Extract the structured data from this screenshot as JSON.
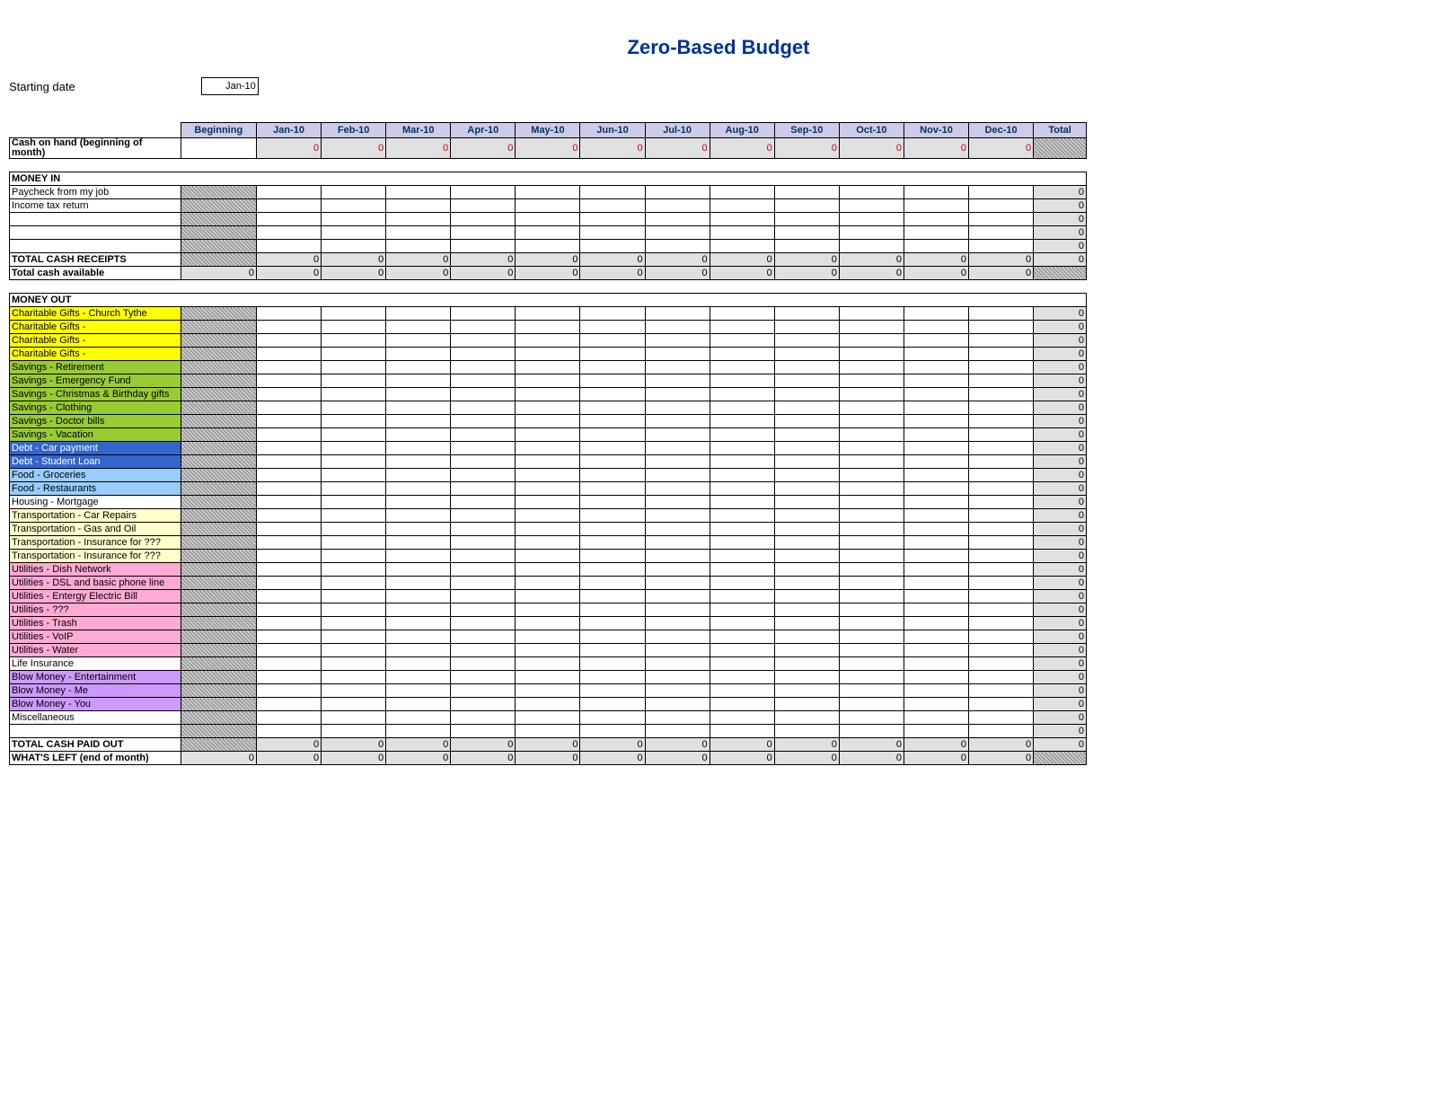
{
  "title": "Zero-Based Budget",
  "starting_date_label": "Starting date",
  "starting_date_value": "Jan-10",
  "headers": [
    "Beginning",
    "Jan-10",
    "Feb-10",
    "Mar-10",
    "Apr-10",
    "May-10",
    "Jun-10",
    "Jul-10",
    "Aug-10",
    "Sep-10",
    "Oct-10",
    "Nov-10",
    "Dec-10",
    "Total"
  ],
  "row_cash_on_hand": "Cash on hand (beginning of month)",
  "section_money_in": "MONEY IN",
  "money_in_rows": [
    "Paycheck from my job",
    "Income tax return",
    "",
    "",
    ""
  ],
  "row_total_receipts": "TOTAL CASH RECEIPTS",
  "row_total_available": "Total cash available",
  "section_money_out": "MONEY OUT",
  "money_out_rows": [
    {
      "label": "Charitable Gifts - Church Tythe",
      "color": "yellow"
    },
    {
      "label": "Charitable Gifts -",
      "color": "yellow"
    },
    {
      "label": "Charitable Gifts -",
      "color": "yellow"
    },
    {
      "label": "Charitable Gifts -",
      "color": "yellow"
    },
    {
      "label": "Savings - Retirement",
      "color": "green"
    },
    {
      "label": "Savings - Emergency Fund",
      "color": "green"
    },
    {
      "label": "Savings - Christmas & Birthday gifts",
      "color": "green"
    },
    {
      "label": "Savings - Clothing",
      "color": "green"
    },
    {
      "label": "Savings - Doctor bills",
      "color": "green"
    },
    {
      "label": "Savings - Vacation",
      "color": "green"
    },
    {
      "label": "Debt - Car payment",
      "color": "blue"
    },
    {
      "label": "Debt - Student Loan",
      "color": "blue"
    },
    {
      "label": "Food - Groceries",
      "color": "lblue"
    },
    {
      "label": "Food - Restaurants",
      "color": "lblue"
    },
    {
      "label": "Housing - Mortgage",
      "color": ""
    },
    {
      "label": "Transportation - Car Repairs",
      "color": "cream"
    },
    {
      "label": "Transportation - Gas and Oil",
      "color": "cream"
    },
    {
      "label": "Transportation - Insurance for ???",
      "color": "cream"
    },
    {
      "label": "Transportation - Insurance for ???",
      "color": "cream"
    },
    {
      "label": "Utilities - Dish Network",
      "color": "pink"
    },
    {
      "label": "Utilities - DSL and basic phone line",
      "color": "pink"
    },
    {
      "label": "Utilities - Entergy Electric Bill",
      "color": "pink"
    },
    {
      "label": "Utilities - ???",
      "color": "pink"
    },
    {
      "label": "Utilities - Trash",
      "color": "pink"
    },
    {
      "label": "Utilities - VoIP",
      "color": "pink"
    },
    {
      "label": "Utilities - Water",
      "color": "pink"
    },
    {
      "label": "Life Insurance",
      "color": ""
    },
    {
      "label": "Blow Money - Entertainment",
      "color": "purple"
    },
    {
      "label": "Blow Money - Me",
      "color": "purple"
    },
    {
      "label": "Blow Money - You",
      "color": "purple"
    },
    {
      "label": "Miscellaneous",
      "color": ""
    },
    {
      "label": "",
      "color": ""
    }
  ],
  "row_total_paid": "TOTAL CASH PAID OUT",
  "row_whats_left": "WHAT'S LEFT (end of month)",
  "zero": "0"
}
